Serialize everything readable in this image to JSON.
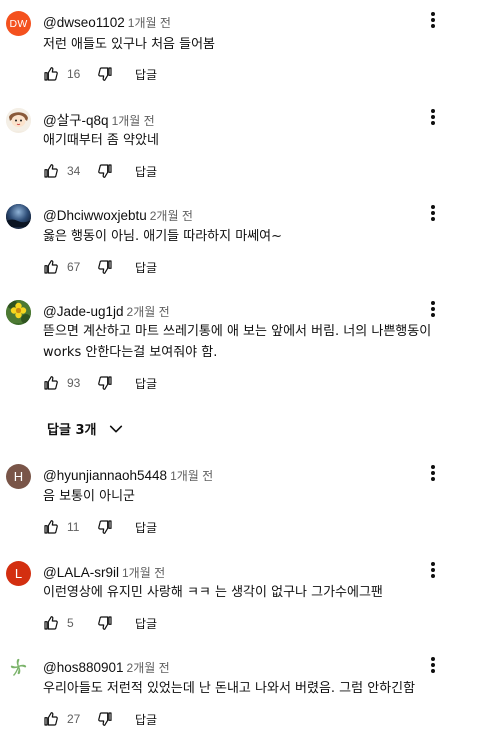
{
  "comments": [
    {
      "author": "@dwseo1102",
      "time": "1개월 전",
      "text": "저런 애들도 있구나 처음 들어봄",
      "likes": "16",
      "reply_label": "답글",
      "avatar": {
        "kind": "letter",
        "letter": "DW",
        "color": "#f4511e"
      }
    },
    {
      "author": "@살구-q8q",
      "time": "1개월 전",
      "text": "애기때부터 좀 약았네",
      "likes": "34",
      "reply_label": "답글",
      "avatar": {
        "kind": "image",
        "icon": "cartoon-face-icon"
      }
    },
    {
      "author": "@Dhciwwoxjebtu",
      "time": "2개월 전",
      "text": "옳은 행동이 아님. 애기들 따라하지 마쎄여~",
      "likes": "67",
      "reply_label": "답글",
      "avatar": {
        "kind": "image",
        "icon": "night-sky-icon"
      }
    },
    {
      "author": "@Jade-ug1jd",
      "time": "2개월 전",
      "text": "뜯으면 계산하고 마트 쓰레기통에 애 보는 앞에서 버림. 너의 나쁜행동이 works 안한다는걸 보여줘야 함.",
      "likes": "93",
      "reply_label": "답글",
      "avatar": {
        "kind": "image",
        "icon": "yellow-flower-icon"
      }
    },
    {
      "author": "@hyunjiannaoh5448",
      "time": "1개월 전",
      "text": "음 보통이 아니군",
      "likes": "11",
      "reply_label": "답글",
      "avatar": {
        "kind": "letter",
        "letter": "H",
        "color": "#795548"
      }
    },
    {
      "author": "@LALA-sr9il",
      "time": "1개월 전",
      "text": "이런영상에 유지민 사랑해 ㅋㅋ 는 생각이 없구나 그가수에그팬",
      "likes": "5",
      "reply_label": "답글",
      "avatar": {
        "kind": "letter",
        "letter": "L",
        "color": "#d32f10"
      }
    },
    {
      "author": "@hos880901",
      "time": "2개월 전",
      "text": "우리아들도 저런적 있었는데 난 돈내고 나와서 버렸음.  그럼 안하긴함",
      "likes": "27",
      "reply_label": "답글",
      "avatar": {
        "kind": "image",
        "icon": "clover-icon"
      }
    }
  ],
  "replies_toggle": {
    "label": "답글 3개",
    "icon": "chevron-down-icon"
  },
  "colors": {
    "text": "#0f0f0f",
    "secondary": "#606060"
  }
}
